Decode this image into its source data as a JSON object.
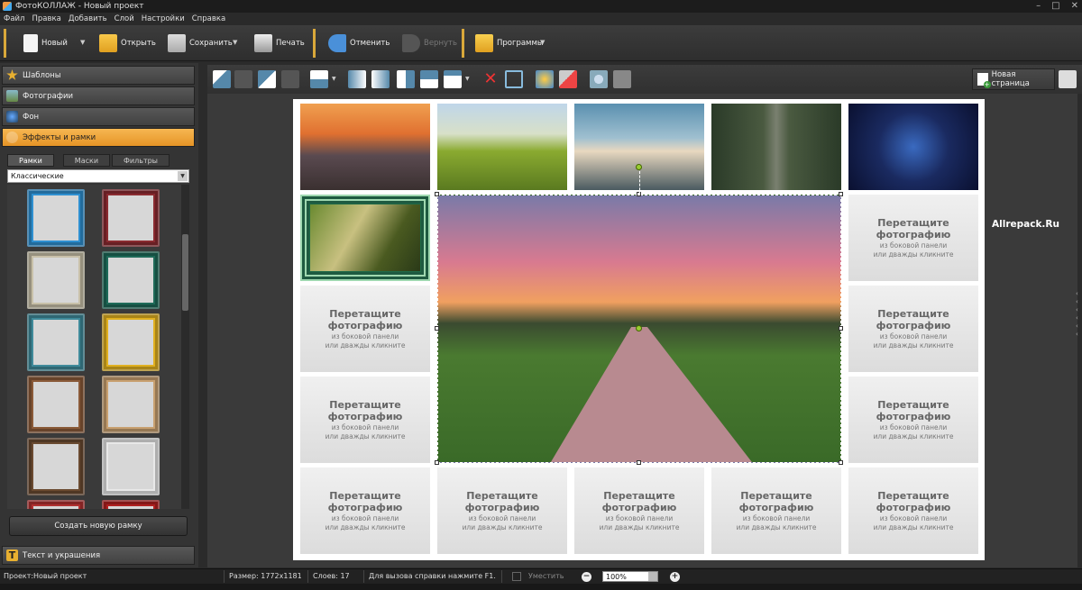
{
  "window": {
    "title": "ФотоКОЛЛАЖ - Новый проект",
    "controls": [
      "–",
      "□",
      "✕"
    ]
  },
  "menu": [
    "Файл",
    "Правка",
    "Добавить",
    "Слой",
    "Настройки",
    "Справка"
  ],
  "toolbar": {
    "new": "Новый",
    "open": "Открыть",
    "save": "Сохранить",
    "print": "Печать",
    "undo": "Отменить",
    "redo": "Вернуть",
    "programs": "Программы"
  },
  "left_panel": {
    "sections": {
      "templates": "Шаблоны",
      "photos": "Фотографии",
      "background": "Фон",
      "effects": "Эффекты и рамки",
      "text": "Текст и украшения"
    },
    "subtabs": [
      "Рамки",
      "Маски",
      "Фильтры"
    ],
    "frame_category": "Классические",
    "create_frame": "Создать новую рамку",
    "frame_colors": [
      "#2e8fd0",
      "#8a2a30",
      "#c8c0a8",
      "#1e6a58",
      "#3f8a9a",
      "#e0b020",
      "#8a5a38",
      "#c8a070",
      "#6a4a30",
      "#e8e8e8",
      "#b03030",
      "#b02020"
    ]
  },
  "edit_toolbar": {
    "new_page": "Новая страница"
  },
  "placeholder": {
    "title": "Перетащите\nфотографию",
    "line1": "из боковой панели",
    "line2": "или дважды кликните"
  },
  "watermark": "Allrepack.Ru",
  "status": {
    "project_label": "Проект:",
    "project_name": "Новый проект",
    "size": "Размер:  1772x1181",
    "layers": "Слоев:  17",
    "help": "Для вызова справки нажмите F1.",
    "fit": "Уместить",
    "zoom": "100%",
    "zoom_out": "−",
    "zoom_in": "+"
  },
  "colors": {
    "accent": "#e8a030",
    "background": "#2b2b2b"
  }
}
